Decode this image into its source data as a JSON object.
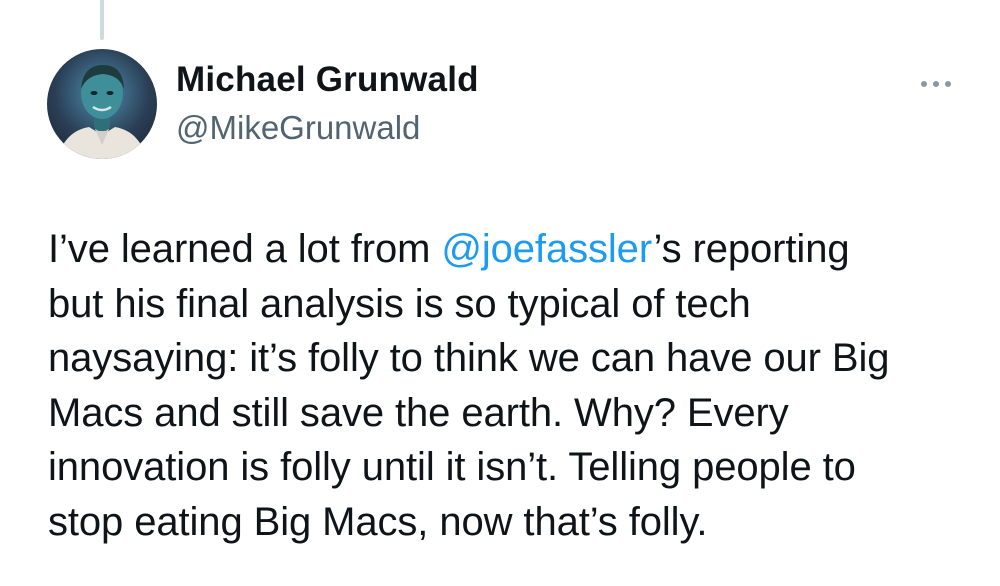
{
  "tweet": {
    "author": {
      "display_name": "Michael Grunwald",
      "handle": "@MikeGrunwald",
      "avatar_icon": "profile-photo"
    },
    "more_icon": "more-horizontal-icon",
    "text": {
      "line1_before": "I’ve learned a lot from ",
      "line1_mention": "@joefassler",
      "line1_after": "’s reporting",
      "line2": "but his final analysis is so typical of tech",
      "line3": "naysaying: it’s folly to think we can have our Big",
      "line4": "Macs and still save the earth. Why? Every",
      "line5": "innovation is folly until it isn’t. Telling people to",
      "line6": "stop eating Big Macs, now that’s folly."
    },
    "colors": {
      "text": "#0f1419",
      "secondary": "#536471",
      "mention": "#1d9bf0",
      "thread_line": "#cfd9de"
    }
  }
}
